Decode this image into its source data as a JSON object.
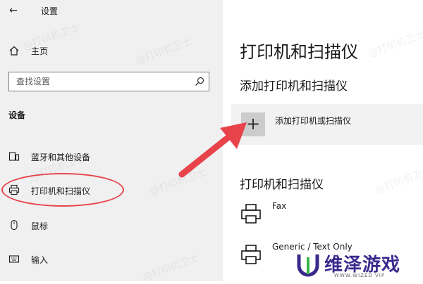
{
  "window": {
    "back_glyph": "←",
    "title": "设置"
  },
  "sidebar": {
    "home": {
      "icon": "home-icon",
      "label": "主页"
    },
    "search": {
      "placeholder": "查找设置",
      "icon": "search-icon"
    },
    "section_title": "设备",
    "items": [
      {
        "icon": "bluetooth-devices-icon",
        "label": "蓝牙和其他设备"
      },
      {
        "icon": "printer-icon",
        "label": "打印机和扫描仪"
      },
      {
        "icon": "mouse-icon",
        "label": "鼠标"
      },
      {
        "icon": "keyboard-icon",
        "label": "输入"
      }
    ]
  },
  "main": {
    "page_title": "打印机和扫描仪",
    "add_section_title": "添加打印机和扫描仪",
    "add_button": {
      "glyph": "+",
      "label": "添加打印机或扫描仪"
    },
    "list_title": "打印机和扫描仪",
    "printers": [
      {
        "icon": "printer-icon",
        "name": "Fax"
      },
      {
        "icon": "printer-icon",
        "name": "Generic / Text Only"
      }
    ]
  },
  "overlay": {
    "watermark": "@打印机卫士",
    "highlight_color": "#e8434b",
    "arrow_color": "#e8434b",
    "brand": {
      "name": "维泽游戏",
      "sub": "WWW.WIZED VIP",
      "color": "#3b2a8e"
    }
  }
}
